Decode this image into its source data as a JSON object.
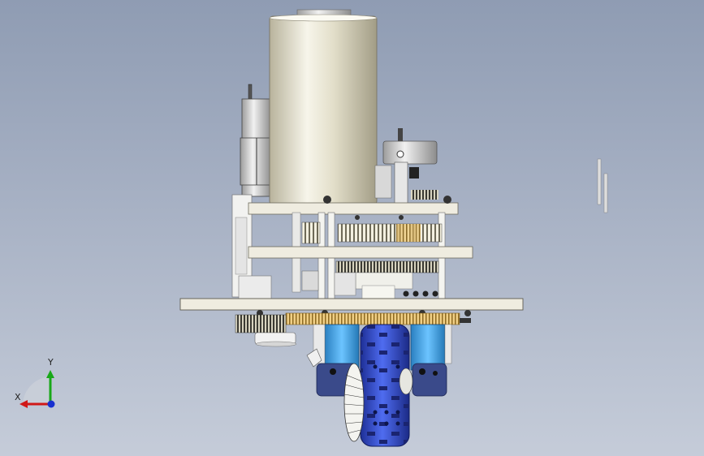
{
  "view": {
    "background_top": "#8f9cb3",
    "background_bottom": "#c5ccd9"
  },
  "triad": {
    "x_label": "X",
    "y_label": "Y",
    "x_color": "#d01818",
    "y_color": "#18a818",
    "z_color": "#1830d0"
  },
  "model": {
    "motor_body": "cylindrical-motor",
    "gear_color": "#e2c07a",
    "wheel_color": "#2c48c8",
    "side_block_color": "#3aa0e0",
    "plate_color": "#e8e4d2"
  }
}
